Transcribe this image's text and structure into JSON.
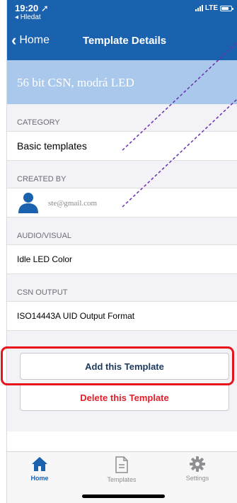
{
  "status_bar": {
    "time": "19:20",
    "back_label": "◂ Hledat",
    "network": "LTE"
  },
  "nav": {
    "back_label": "Home",
    "title": "Template Details"
  },
  "banner": {
    "title": "56 bit CSN, modrá LED"
  },
  "sections": {
    "category": {
      "label": "CATEGORY",
      "value": "Basic templates"
    },
    "created_by": {
      "label": "CREATED BY",
      "value": "ste@gmail.com"
    },
    "audio_visual": {
      "label": "AUDIO/VISUAL",
      "value": "Idle LED Color"
    },
    "csn_output": {
      "label": "CSN OUTPUT",
      "value": "ISO14443A UID Output Format"
    }
  },
  "buttons": {
    "add": "Add this Template",
    "delete": "Delete this Template"
  },
  "tabs": [
    {
      "label": "Home",
      "icon": "home-icon"
    },
    {
      "label": "Templates",
      "icon": "document-icon"
    },
    {
      "label": "Settings",
      "icon": "gear-icon"
    }
  ],
  "colors": {
    "brand": "#1a62ad",
    "banner": "#a9c8ec",
    "delete": "#e0202a",
    "highlight": "#e8141c",
    "annotation": "#6a2fb0"
  }
}
